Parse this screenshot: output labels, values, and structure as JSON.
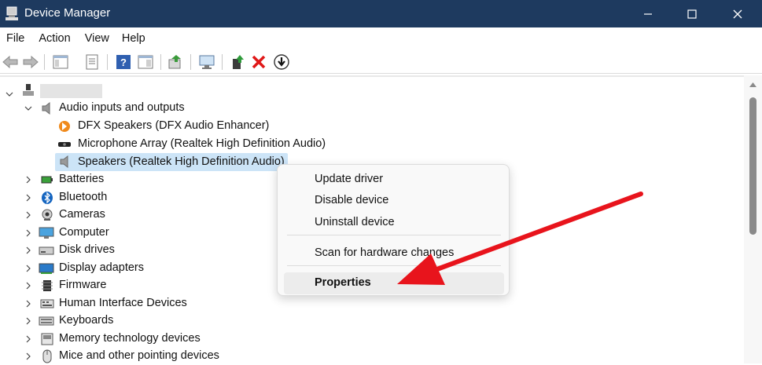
{
  "window": {
    "title": "Device Manager",
    "controls": [
      "minimize",
      "maximize",
      "close"
    ]
  },
  "menubar": {
    "items": [
      "File",
      "Action",
      "View",
      "Help"
    ]
  },
  "toolbar": {
    "buttons": [
      "back-icon",
      "forward-icon",
      "console-tree-icon",
      "properties-page-icon",
      "help-icon",
      "action-pane-icon",
      "update-driver-icon",
      "scan-hardware-icon",
      "enable-device-icon",
      "uninstall-icon",
      "disable-device-icon"
    ]
  },
  "tree": {
    "root_label": "",
    "audio_category": "Audio inputs and outputs",
    "audio_children": [
      "DFX Speakers (DFX Audio Enhancer)",
      "Microphone Array (Realtek High Definition Audio)",
      "Speakers (Realtek High Definition Audio)"
    ],
    "categories": [
      "Batteries",
      "Bluetooth",
      "Cameras",
      "Computer",
      "Disk drives",
      "Display adapters",
      "Firmware",
      "Human Interface Devices",
      "Keyboards",
      "Memory technology devices",
      "Mice and other pointing devices"
    ]
  },
  "context_menu": {
    "items": [
      "Update driver",
      "Disable device",
      "Uninstall device",
      "Scan for hardware changes",
      "Properties"
    ],
    "highlighted": "Properties"
  },
  "colors": {
    "titlebar": "#1e3a5f",
    "selection": "#cce4f7",
    "annotation_arrow": "#e8141c"
  }
}
